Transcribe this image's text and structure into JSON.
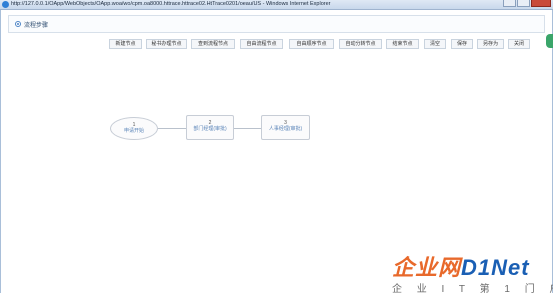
{
  "window": {
    "title": "http://127.0.0.1/OApp/WebObjects/OApp.woa/wo/cpm.oa8000.httrace.httrace02.HtTrace0201/oeau/US - Windows Internet Explorer"
  },
  "page": {
    "title": "流程步骤"
  },
  "toolbar": {
    "buttons": [
      "新建节点",
      "秘书办理节点",
      "查到流程节点",
      "自由流程节点",
      "自由顺序节点",
      "自动分转节点",
      "结束节点",
      "清空",
      "保存",
      "另存为",
      "关闭"
    ]
  },
  "flow": {
    "nodes": [
      {
        "num": "1",
        "label": "申请开始"
      },
      {
        "num": "2",
        "label": "部门经理(审批)"
      },
      {
        "num": "3",
        "label": "人事经理(审批)"
      }
    ]
  },
  "watermark": {
    "brand_a": "企业网",
    "brand_b": "D1Net",
    "subtitle": "企 业 I T 第 1 门 户"
  }
}
